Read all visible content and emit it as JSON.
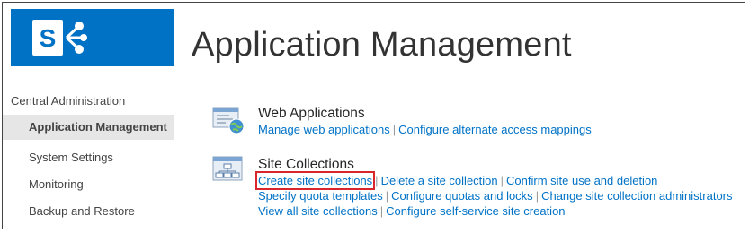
{
  "page": {
    "title": "Application Management"
  },
  "brand": {
    "tile_color": "#0072c6",
    "highlight_color": "#d9262d"
  },
  "leftnav": {
    "root": "Central Administration",
    "items": [
      {
        "label": "Application Management",
        "selected": true
      },
      {
        "label": "System Settings"
      },
      {
        "label": "Monitoring"
      },
      {
        "label": "Backup and Restore"
      }
    ]
  },
  "sections": {
    "web_apps": {
      "title": "Web Applications",
      "icon": "web-applications-icon",
      "links": [
        "Manage web applications",
        "Configure alternate access mappings"
      ]
    },
    "site_collections": {
      "title": "Site Collections",
      "icon": "site-collections-icon",
      "row1": [
        "Create site collections",
        "Delete a site collection",
        "Confirm site use and deletion"
      ],
      "row2": [
        "Specify quota templates",
        "Configure quotas and locks",
        "Change site collection administrators"
      ],
      "row3": [
        "View all site collections",
        "Configure self-service site creation"
      ]
    }
  }
}
